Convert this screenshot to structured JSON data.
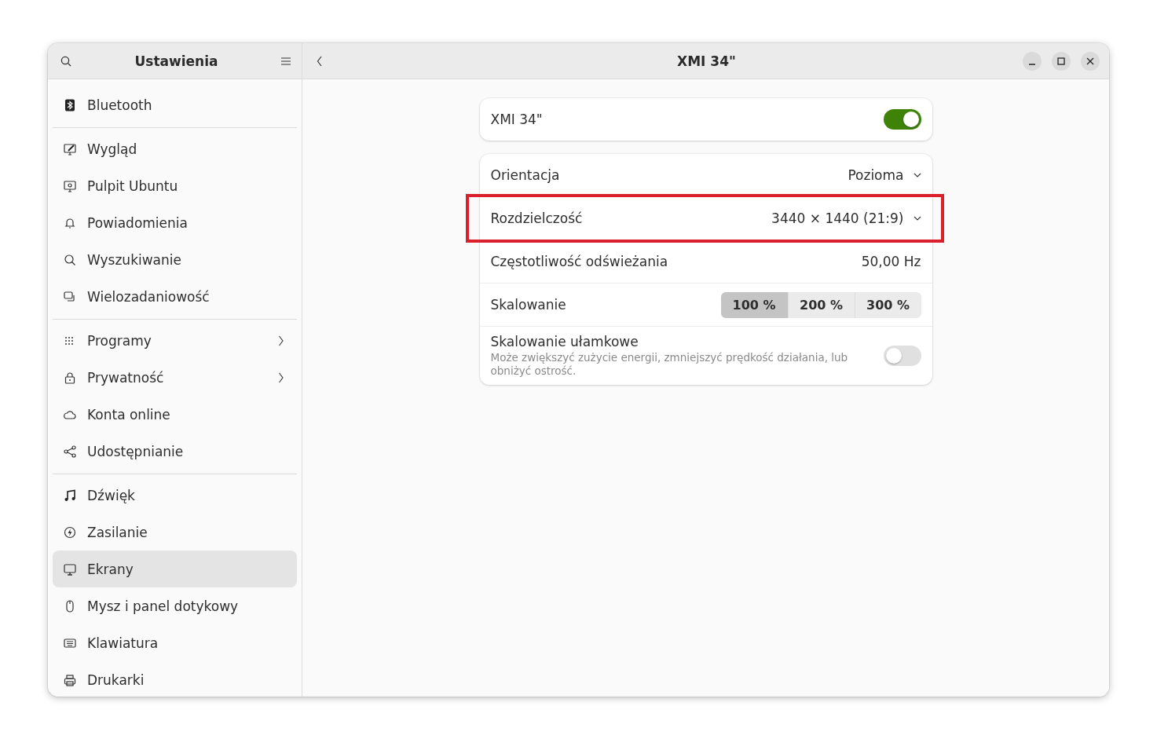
{
  "sidebar": {
    "title": "Ustawienia",
    "groups": [
      [
        {
          "label": "Bluetooth",
          "selected": false,
          "submenu": false
        }
      ],
      [
        {
          "label": "Wygląd",
          "selected": false,
          "submenu": false
        },
        {
          "label": "Pulpit Ubuntu",
          "selected": false,
          "submenu": false
        },
        {
          "label": "Powiadomienia",
          "selected": false,
          "submenu": false
        },
        {
          "label": "Wyszukiwanie",
          "selected": false,
          "submenu": false
        },
        {
          "label": "Wielozadaniowość",
          "selected": false,
          "submenu": false
        }
      ],
      [
        {
          "label": "Programy",
          "selected": false,
          "submenu": true
        },
        {
          "label": "Prywatność",
          "selected": false,
          "submenu": true
        },
        {
          "label": "Konta online",
          "selected": false,
          "submenu": false
        },
        {
          "label": "Udostępnianie",
          "selected": false,
          "submenu": false
        }
      ],
      [
        {
          "label": "Dźwięk",
          "selected": false,
          "submenu": false
        },
        {
          "label": "Zasilanie",
          "selected": false,
          "submenu": false
        },
        {
          "label": "Ekrany",
          "selected": true,
          "submenu": false
        },
        {
          "label": "Mysz i panel dotykowy",
          "selected": false,
          "submenu": false
        },
        {
          "label": "Klawiatura",
          "selected": false,
          "submenu": false
        },
        {
          "label": "Drukarki",
          "selected": false,
          "submenu": false
        }
      ]
    ]
  },
  "page": {
    "title": "XMI 34\"",
    "monitor": {
      "label": "XMI 34\"",
      "on": true
    },
    "rows": [
      {
        "kind": "dropdown",
        "label": "Orientacja",
        "value": "Pozioma",
        "highlighted": false
      },
      {
        "kind": "dropdown",
        "label": "Rozdzielczość",
        "value": "3440 × 1440 (21:9)",
        "highlighted": true
      },
      {
        "kind": "value",
        "label": "Częstotliwość odświeżania",
        "value": "50,00 Hz",
        "highlighted": false
      },
      {
        "kind": "segmented",
        "label": "Skalowanie",
        "highlighted": false,
        "options": [
          {
            "label": "100 %",
            "selected": true
          },
          {
            "label": "200 %",
            "selected": false
          },
          {
            "label": "300 %",
            "selected": false
          }
        ]
      },
      {
        "kind": "switch",
        "label": "Skalowanie ułamkowe",
        "description": "Może zwiększyć zużycie energii, zmniejszyć prędkość działania, lub obniżyć ostrość.",
        "on": false,
        "highlighted": false
      }
    ]
  }
}
